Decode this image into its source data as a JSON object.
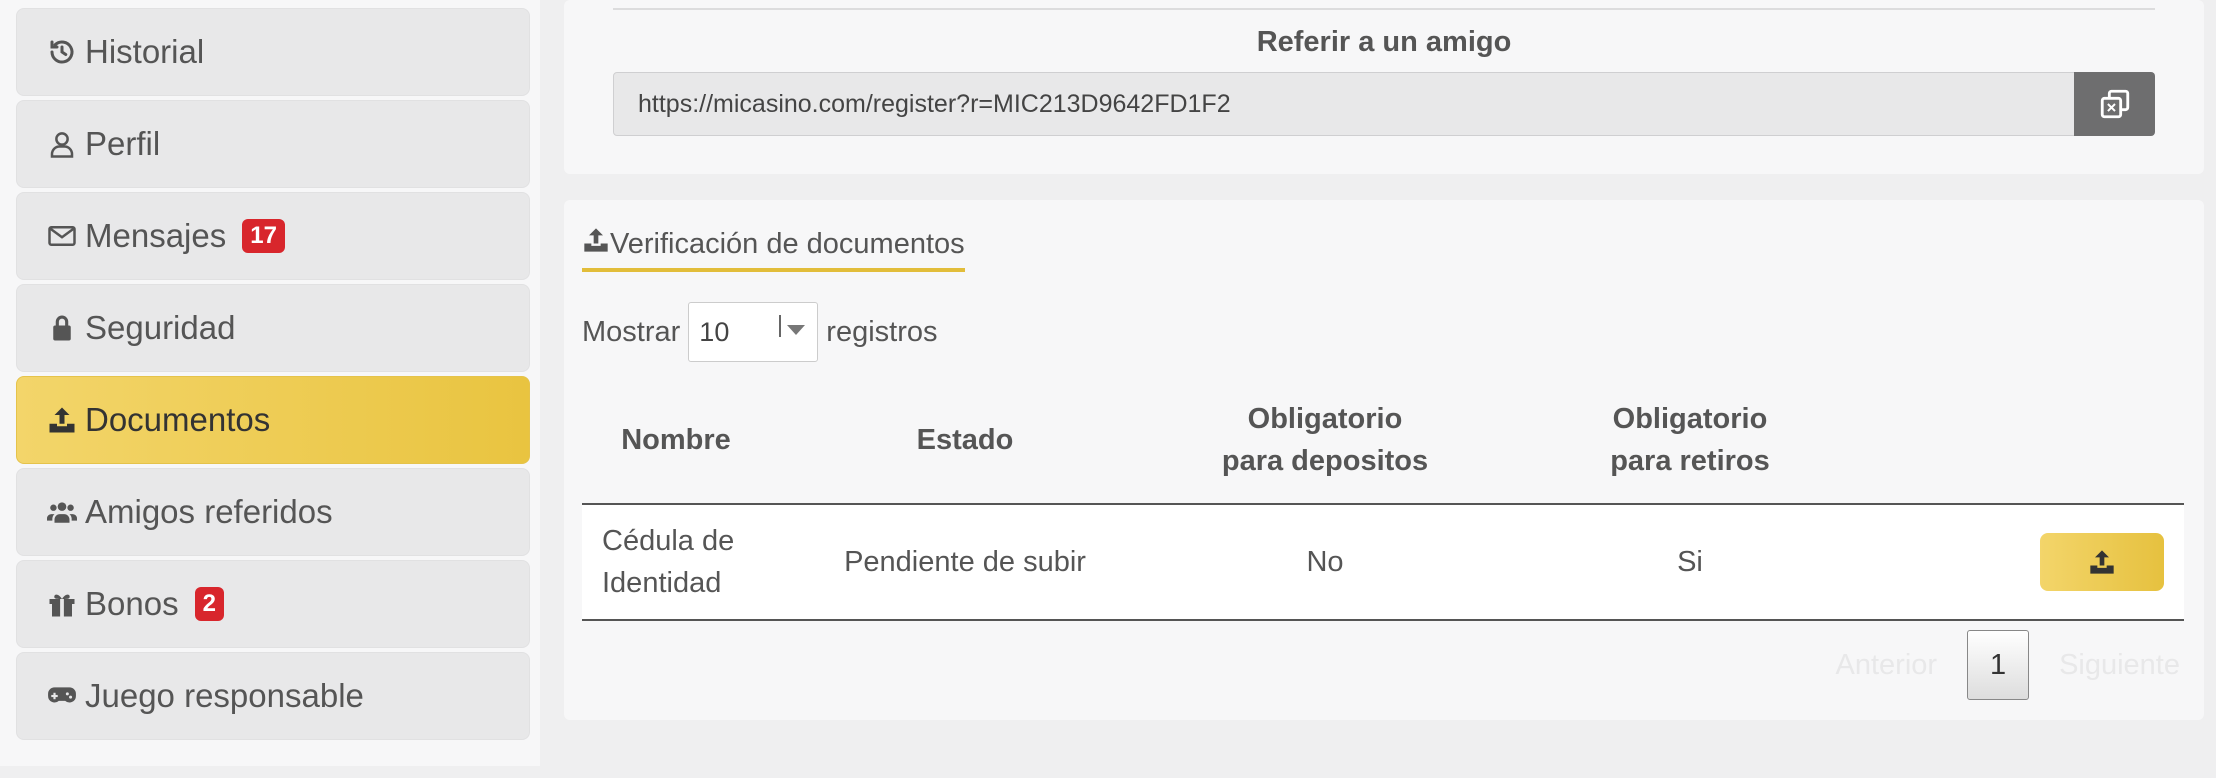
{
  "sidebar": {
    "items": [
      {
        "label": "Historial",
        "icon": "history-icon",
        "badge": ""
      },
      {
        "label": "Perfil",
        "icon": "user-icon",
        "badge": ""
      },
      {
        "label": "Mensajes",
        "icon": "envelope-icon",
        "badge": "17"
      },
      {
        "label": "Seguridad",
        "icon": "lock-icon",
        "badge": ""
      },
      {
        "label": "Documentos",
        "icon": "upload-icon",
        "badge": "",
        "active": true
      },
      {
        "label": "Amigos referidos",
        "icon": "users-icon",
        "badge": ""
      },
      {
        "label": "Bonos",
        "icon": "gift-icon",
        "badge": "2"
      },
      {
        "label": "Juego responsable",
        "icon": "gamepad-icon",
        "badge": ""
      }
    ]
  },
  "referral": {
    "title": "Referir a un amigo",
    "url": "https://micasino.com/register?r=MIC213D9642FD1F2"
  },
  "documents": {
    "tab_label": "Verificación de documentos",
    "show_prefix": "Mostrar",
    "page_size": "10",
    "show_suffix": "registros",
    "columns": [
      "Nombre",
      "Estado",
      "Obligatorio para depositos",
      "Obligatorio para retiros",
      ""
    ],
    "rows": [
      {
        "nombre": "Cédula de Identidad",
        "estado": "Pendiente de subir",
        "depositos": "No",
        "retiros": "Si"
      }
    ],
    "pager": {
      "prev": "Anterior",
      "page": "1",
      "next": "Siguiente"
    }
  },
  "colors": {
    "accent": "#e9c440",
    "badge": "#d8262c",
    "copy_button": "#6e6e6f"
  }
}
